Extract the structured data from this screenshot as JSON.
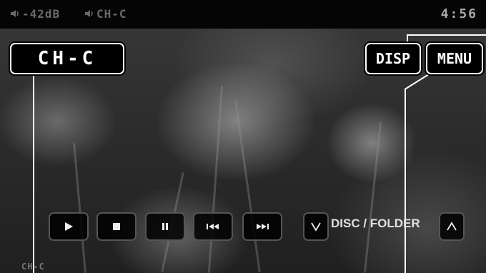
{
  "status_bar": {
    "volume_text": "-42dB",
    "volume_icon": "speaker-icon",
    "channel_text": "CH-C",
    "channel_icon": "speaker-channel-icon",
    "clock": "4:56"
  },
  "channel_label": "CH-C",
  "buttons": {
    "disp": "DISP",
    "menu": "MENU"
  },
  "controls": [
    {
      "name": "play",
      "icon": "play-icon"
    },
    {
      "name": "stop",
      "icon": "stop-icon"
    },
    {
      "name": "pause",
      "icon": "pause-icon"
    },
    {
      "name": "previous",
      "icon": "skip-previous-icon"
    },
    {
      "name": "next",
      "icon": "skip-next-icon"
    }
  ],
  "disc_folder": {
    "label": "DISC / FOLDER",
    "down_icon": "chevron-down-icon",
    "up_icon": "chevron-up-icon"
  },
  "corner_label": "CH-C",
  "colors": {
    "status_bar_bg": "#050505",
    "status_text": "#6a6a6a",
    "button_border": "#ffffff",
    "button_bg": "#000000",
    "control_border": "#555555"
  }
}
